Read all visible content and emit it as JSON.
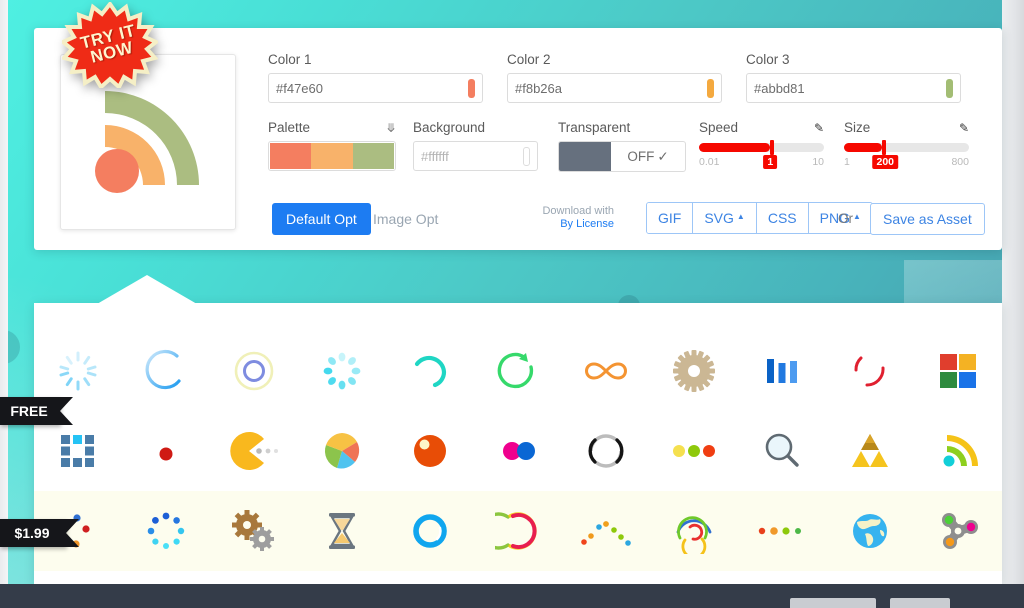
{
  "theme": {
    "accent_blue": "#1d7cf2",
    "slider_red": "#f60800",
    "bg_teal_start": "#4ff0e2",
    "bg_teal_end": "#4795a8",
    "footer_navy": "#343c49",
    "paid_row_bg": "#fdfdee"
  },
  "badge": {
    "line1": "TRY IT",
    "line2": "NOW",
    "color": "#ef2b16"
  },
  "editor": {
    "colors": [
      {
        "label": "Color 1",
        "value": "#f47e60",
        "swatch": "#f47e60"
      },
      {
        "label": "Color 2",
        "value": "#f8b26a",
        "swatch": "#f4a93f"
      },
      {
        "label": "Color 3",
        "value": "#abbd81",
        "swatch": "#a3bd74"
      }
    ],
    "palette": {
      "label": "Palette",
      "chevron_icon": "chevron-double-down-icon",
      "swatches": [
        "#f47e60",
        "#f8b26a",
        "#abbd81"
      ]
    },
    "background": {
      "label": "Background",
      "value": "#ffffff",
      "placeholder": "#ffffff"
    },
    "transparent": {
      "label": "Transparent",
      "state": "OFF",
      "check_icon": "check-icon"
    },
    "speed": {
      "label": "Speed",
      "edit_icon": "pencil-icon",
      "min": "0.01",
      "max": "10",
      "value": "1",
      "fill_percent": 57
    },
    "size": {
      "label": "Size",
      "edit_icon": "pencil-icon",
      "min": "1",
      "max": "800",
      "value": "200",
      "fill_percent": 30
    },
    "actions": {
      "default_opt": "Default Opt",
      "image_opt": "Image Opt",
      "download_with": "Download with",
      "by_license": "By License",
      "formats": [
        {
          "label": "GIF",
          "caret": false
        },
        {
          "label": "SVG",
          "caret": true
        },
        {
          "label": "CSS",
          "caret": false
        },
        {
          "label": "PNG",
          "caret": true
        }
      ],
      "or": "Or",
      "save_as_asset": "Save as Asset"
    }
  },
  "gallery": {
    "ribbons": {
      "free": "FREE",
      "price": "$1.99"
    },
    "rows": [
      {
        "tier": "free",
        "icons": [
          "spinner-rays-icon",
          "crescent-arc-icon",
          "double-ring-icon",
          "dot-spinner-icon",
          "arc-arrow-icon",
          "refresh-circle-icon",
          "infinity-icon",
          "gear-icon",
          "equalizer-bars-icon",
          "dashed-arc-icon",
          "four-squares-icon"
        ]
      },
      {
        "tier": "free",
        "icons": [
          "grid-squares-icon",
          "red-dot-icon",
          "pacman-dots-icon",
          "pie-chart-icon",
          "orange-circle-icon",
          "two-dots-icon",
          "gradient-ring-icon",
          "three-dots-icon",
          "magnifier-icon",
          "triforce-icon",
          "rss-signal-icon"
        ]
      },
      {
        "tier": "paid",
        "icons": [
          "scatter-dots-icon",
          "dot-ring-icon",
          "double-gear-icon",
          "hourglass-icon",
          "blue-ring-icon",
          "multicolor-arc-icon",
          "arc-dots-icon",
          "spiral-rings-icon",
          "dots-row-icon",
          "globe-icon",
          "fidget-spinner-icon"
        ]
      }
    ]
  }
}
